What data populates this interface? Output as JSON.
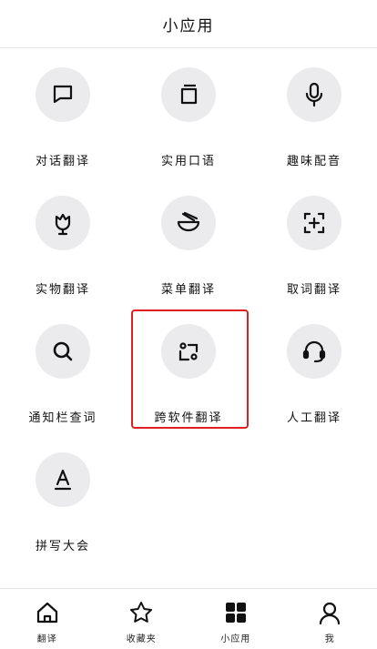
{
  "header": {
    "title": "小应用"
  },
  "tiles": [
    {
      "label": "对话翻译",
      "icon": "chat-bubble-icon"
    },
    {
      "label": "实用口语",
      "icon": "book-icon"
    },
    {
      "label": "趣味配音",
      "icon": "microphone-icon"
    },
    {
      "label": "实物翻译",
      "icon": "flower-icon"
    },
    {
      "label": "菜单翻译",
      "icon": "noodle-bowl-icon"
    },
    {
      "label": "取词翻译",
      "icon": "crop-plus-icon"
    },
    {
      "label": "通知栏查词",
      "icon": "search-icon"
    },
    {
      "label": "跨软件翻译",
      "icon": "cross-app-icon"
    },
    {
      "label": "人工翻译",
      "icon": "headset-icon"
    },
    {
      "label": "拼写大会",
      "icon": "letter-a-icon"
    }
  ],
  "tabbar": {
    "items": [
      {
        "label": "翻译",
        "icon": "home-icon"
      },
      {
        "label": "收藏夹",
        "icon": "star-icon"
      },
      {
        "label": "小应用",
        "icon": "apps-grid-icon",
        "active": true
      },
      {
        "label": "我",
        "icon": "person-icon"
      }
    ]
  },
  "colors": {
    "highlight": "#e02020",
    "circle_bg": "#ebebed",
    "text": "#111111"
  }
}
